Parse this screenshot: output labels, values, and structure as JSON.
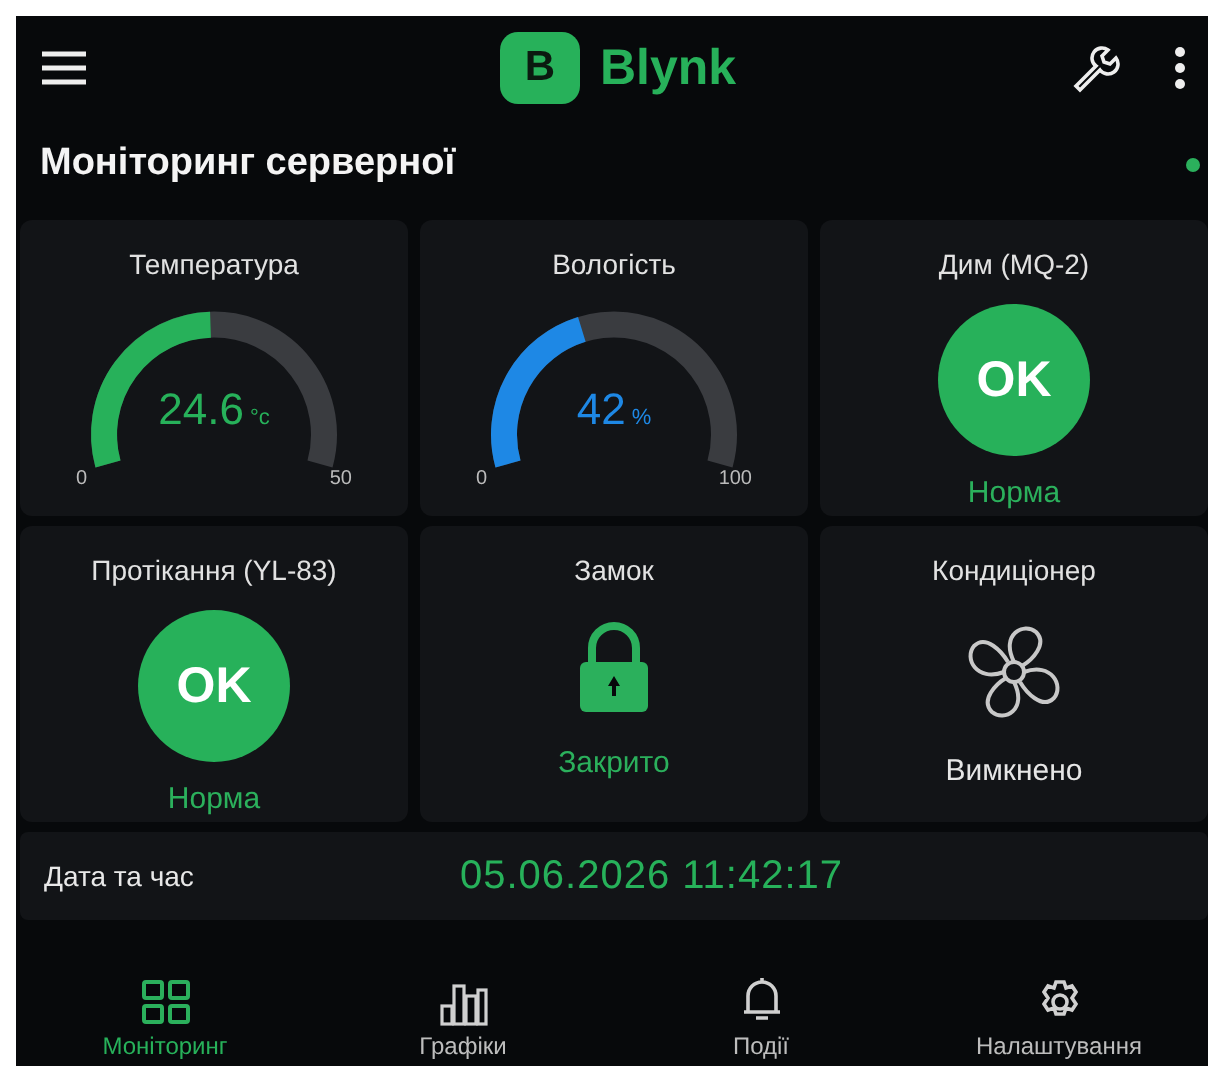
{
  "app_bar": {
    "logo_letter": "B",
    "brand": "Blynk"
  },
  "dashboard": {
    "title": "Моніторинг серверної",
    "online": true
  },
  "tiles": [
    {
      "kind": "gauge",
      "title": "Температура",
      "value": "24.6",
      "unit": "°c",
      "min": "0",
      "max": "50",
      "color": "#27b15a"
    },
    {
      "kind": "gauge",
      "title": "Вологість",
      "value": "42",
      "unit": "%",
      "min": "0",
      "max": "100",
      "color": "#1e88e5"
    },
    {
      "kind": "status",
      "title": "Дим (MQ-2)",
      "badge": "OK",
      "status": "Норма",
      "active": true
    },
    {
      "kind": "status",
      "title": "Протікання (YL-83)",
      "badge": "OK",
      "status": "Норма",
      "active": true
    },
    {
      "kind": "lock",
      "title": "Замок",
      "status": "Закрито",
      "active": true
    },
    {
      "kind": "fan",
      "title": "Кондиціонер",
      "status": "Вимкнено",
      "active": false
    }
  ],
  "datetime": {
    "label": "Дата та час",
    "value": "05.06.2026 11:42:17"
  },
  "nav": [
    {
      "label": "Моніторинг",
      "selected": true
    },
    {
      "label": "Графіки",
      "selected": false
    },
    {
      "label": "Події",
      "selected": false
    },
    {
      "label": "Налаштування",
      "selected": false
    }
  ]
}
